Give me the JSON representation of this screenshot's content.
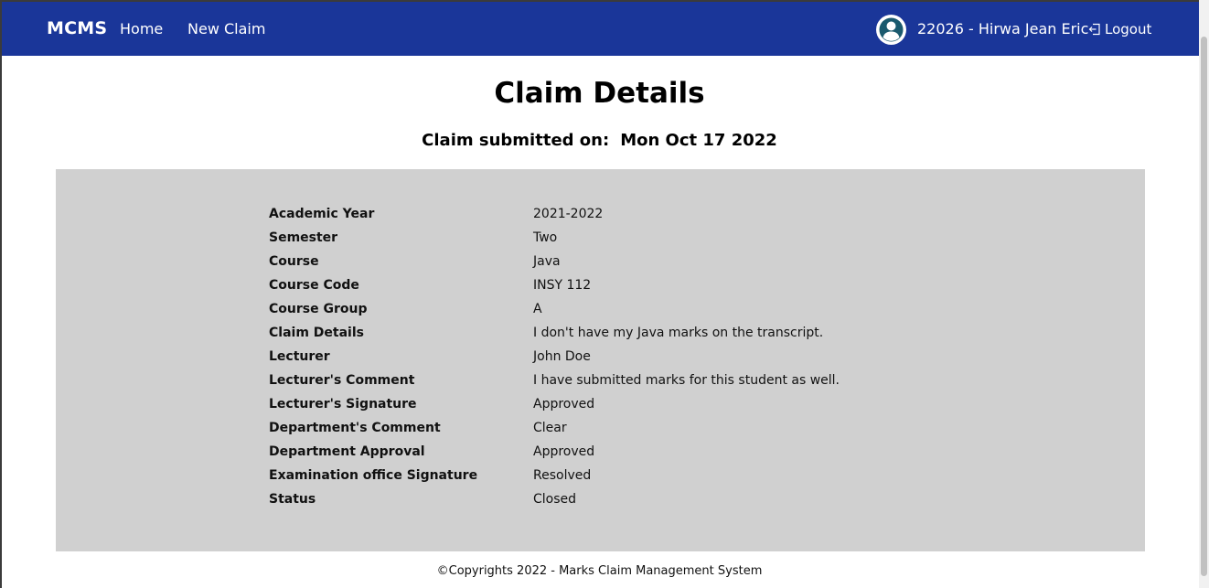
{
  "navbar": {
    "brand": "MCMS",
    "links": [
      "Home",
      "New Claim"
    ],
    "user": "22026 - Hirwa Jean Eric",
    "logout_label": "Logout",
    "color": "#1a3699"
  },
  "page": {
    "title": "Claim Details",
    "submitted_label": "Claim submitted on:",
    "submitted_date": "Mon Oct 17 2022"
  },
  "details": [
    {
      "label": "Academic Year",
      "value": "2021-2022"
    },
    {
      "label": "Semester",
      "value": "Two"
    },
    {
      "label": "Course",
      "value": "Java"
    },
    {
      "label": "Course Code",
      "value": "INSY 112"
    },
    {
      "label": "Course Group",
      "value": "A"
    },
    {
      "label": "Claim Details",
      "value": "I don't have my Java marks on the transcript."
    },
    {
      "label": "Lecturer",
      "value": "John Doe"
    },
    {
      "label": "Lecturer's Comment",
      "value": "I have submitted marks for this student as well."
    },
    {
      "label": "Lecturer's Signature",
      "value": "Approved"
    },
    {
      "label": "Department's Comment",
      "value": "Clear"
    },
    {
      "label": "Department Approval",
      "value": "Approved"
    },
    {
      "label": "Examination office Signature",
      "value": "Resolved"
    },
    {
      "label": "Status",
      "value": "Closed"
    }
  ],
  "footer": {
    "text": "©Copyrights 2022 - Marks Claim Management System"
  },
  "icons": {
    "avatar": "user-circle-icon",
    "logout": "logout-icon"
  }
}
